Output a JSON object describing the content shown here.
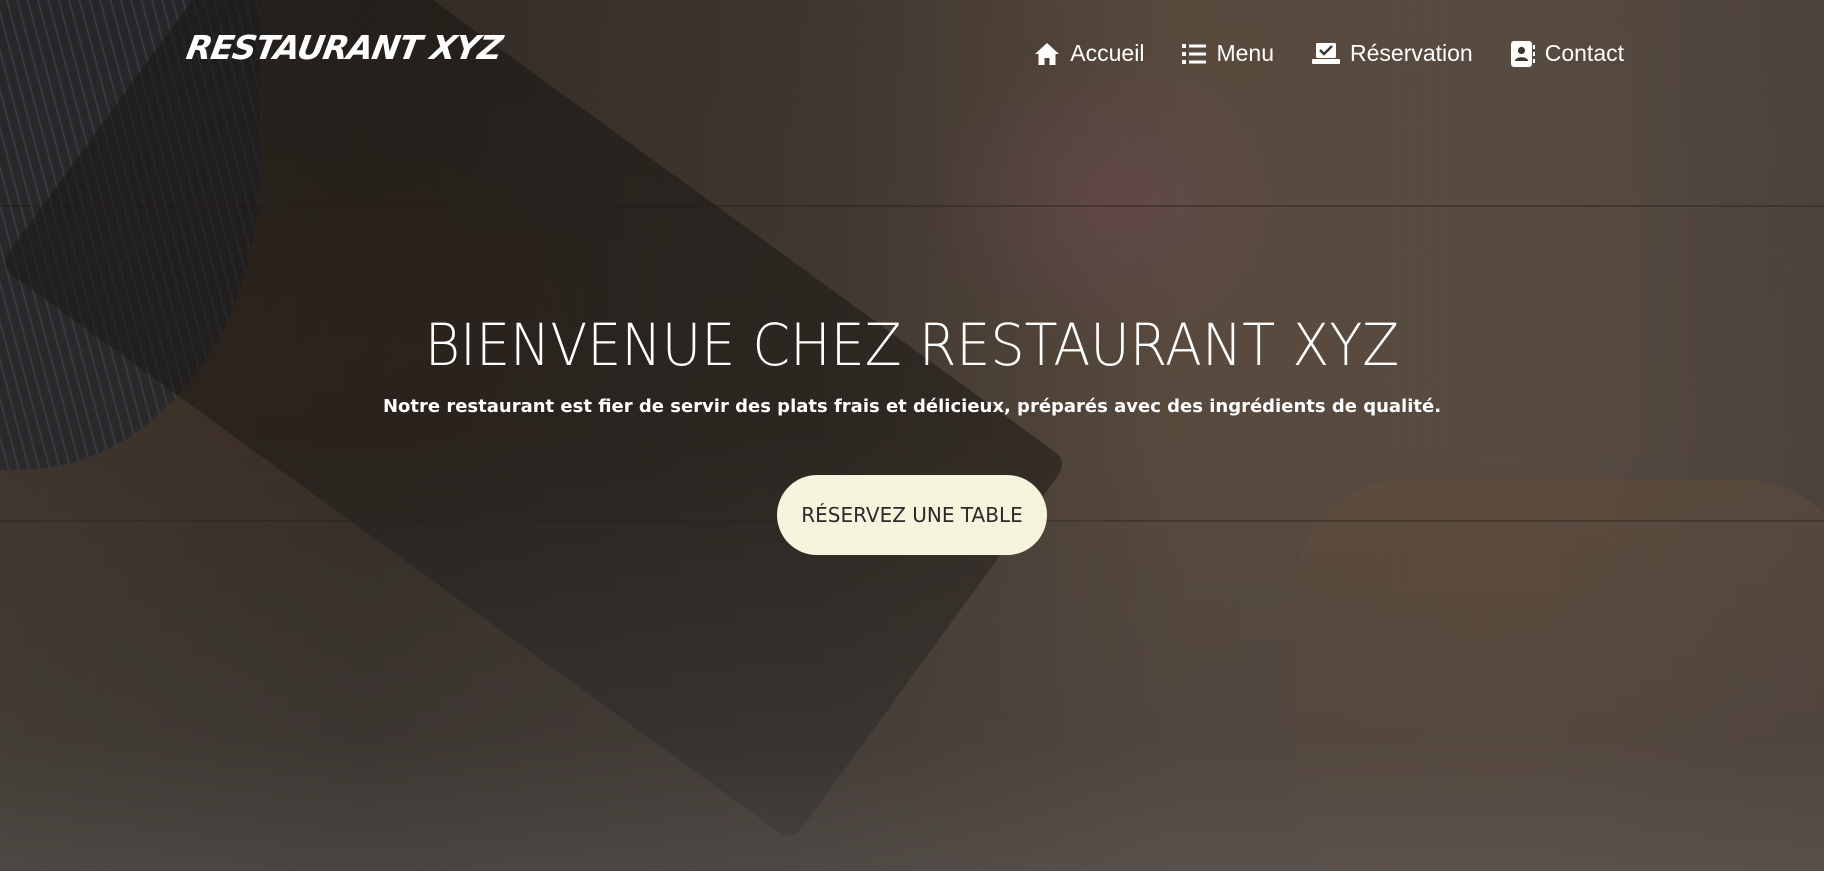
{
  "brand": {
    "logo_text": "RESTAURANT XYZ"
  },
  "nav": {
    "items": [
      {
        "label": "Accueil",
        "icon": "home-icon"
      },
      {
        "label": "Menu",
        "icon": "list-icon"
      },
      {
        "label": "Réservation",
        "icon": "reservation-icon"
      },
      {
        "label": "Contact",
        "icon": "contact-card-icon"
      }
    ]
  },
  "hero": {
    "title": "BIENVENUE CHEZ RESTAURANT XYZ",
    "subtitle": "Notre restaurant est fier de servir des plats frais et délicieux, préparés avec des ingrédients de qualité.",
    "cta_label": "RÉSERVEZ UNE TABLE"
  },
  "colors": {
    "cta_background": "#f6f4dc",
    "text": "#ffffff"
  }
}
